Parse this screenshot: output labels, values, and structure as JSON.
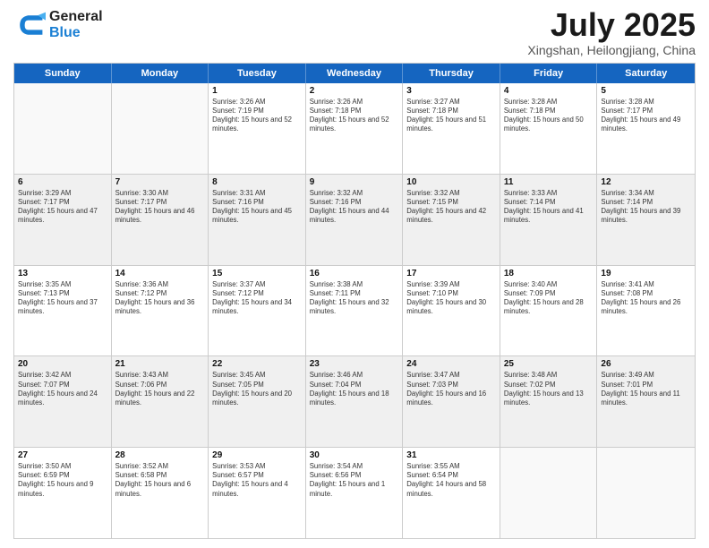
{
  "header": {
    "logo_general": "General",
    "logo_blue": "Blue",
    "month": "July 2025",
    "location": "Xingshan, Heilongjiang, China"
  },
  "weekdays": [
    "Sunday",
    "Monday",
    "Tuesday",
    "Wednesday",
    "Thursday",
    "Friday",
    "Saturday"
  ],
  "rows": [
    [
      {
        "day": "",
        "info": ""
      },
      {
        "day": "",
        "info": ""
      },
      {
        "day": "1",
        "info": "Sunrise: 3:26 AM\nSunset: 7:19 PM\nDaylight: 15 hours and 52 minutes."
      },
      {
        "day": "2",
        "info": "Sunrise: 3:26 AM\nSunset: 7:18 PM\nDaylight: 15 hours and 52 minutes."
      },
      {
        "day": "3",
        "info": "Sunrise: 3:27 AM\nSunset: 7:18 PM\nDaylight: 15 hours and 51 minutes."
      },
      {
        "day": "4",
        "info": "Sunrise: 3:28 AM\nSunset: 7:18 PM\nDaylight: 15 hours and 50 minutes."
      },
      {
        "day": "5",
        "info": "Sunrise: 3:28 AM\nSunset: 7:17 PM\nDaylight: 15 hours and 49 minutes."
      }
    ],
    [
      {
        "day": "6",
        "info": "Sunrise: 3:29 AM\nSunset: 7:17 PM\nDaylight: 15 hours and 47 minutes."
      },
      {
        "day": "7",
        "info": "Sunrise: 3:30 AM\nSunset: 7:17 PM\nDaylight: 15 hours and 46 minutes."
      },
      {
        "day": "8",
        "info": "Sunrise: 3:31 AM\nSunset: 7:16 PM\nDaylight: 15 hours and 45 minutes."
      },
      {
        "day": "9",
        "info": "Sunrise: 3:32 AM\nSunset: 7:16 PM\nDaylight: 15 hours and 44 minutes."
      },
      {
        "day": "10",
        "info": "Sunrise: 3:32 AM\nSunset: 7:15 PM\nDaylight: 15 hours and 42 minutes."
      },
      {
        "day": "11",
        "info": "Sunrise: 3:33 AM\nSunset: 7:14 PM\nDaylight: 15 hours and 41 minutes."
      },
      {
        "day": "12",
        "info": "Sunrise: 3:34 AM\nSunset: 7:14 PM\nDaylight: 15 hours and 39 minutes."
      }
    ],
    [
      {
        "day": "13",
        "info": "Sunrise: 3:35 AM\nSunset: 7:13 PM\nDaylight: 15 hours and 37 minutes."
      },
      {
        "day": "14",
        "info": "Sunrise: 3:36 AM\nSunset: 7:12 PM\nDaylight: 15 hours and 36 minutes."
      },
      {
        "day": "15",
        "info": "Sunrise: 3:37 AM\nSunset: 7:12 PM\nDaylight: 15 hours and 34 minutes."
      },
      {
        "day": "16",
        "info": "Sunrise: 3:38 AM\nSunset: 7:11 PM\nDaylight: 15 hours and 32 minutes."
      },
      {
        "day": "17",
        "info": "Sunrise: 3:39 AM\nSunset: 7:10 PM\nDaylight: 15 hours and 30 minutes."
      },
      {
        "day": "18",
        "info": "Sunrise: 3:40 AM\nSunset: 7:09 PM\nDaylight: 15 hours and 28 minutes."
      },
      {
        "day": "19",
        "info": "Sunrise: 3:41 AM\nSunset: 7:08 PM\nDaylight: 15 hours and 26 minutes."
      }
    ],
    [
      {
        "day": "20",
        "info": "Sunrise: 3:42 AM\nSunset: 7:07 PM\nDaylight: 15 hours and 24 minutes."
      },
      {
        "day": "21",
        "info": "Sunrise: 3:43 AM\nSunset: 7:06 PM\nDaylight: 15 hours and 22 minutes."
      },
      {
        "day": "22",
        "info": "Sunrise: 3:45 AM\nSunset: 7:05 PM\nDaylight: 15 hours and 20 minutes."
      },
      {
        "day": "23",
        "info": "Sunrise: 3:46 AM\nSunset: 7:04 PM\nDaylight: 15 hours and 18 minutes."
      },
      {
        "day": "24",
        "info": "Sunrise: 3:47 AM\nSunset: 7:03 PM\nDaylight: 15 hours and 16 minutes."
      },
      {
        "day": "25",
        "info": "Sunrise: 3:48 AM\nSunset: 7:02 PM\nDaylight: 15 hours and 13 minutes."
      },
      {
        "day": "26",
        "info": "Sunrise: 3:49 AM\nSunset: 7:01 PM\nDaylight: 15 hours and 11 minutes."
      }
    ],
    [
      {
        "day": "27",
        "info": "Sunrise: 3:50 AM\nSunset: 6:59 PM\nDaylight: 15 hours and 9 minutes."
      },
      {
        "day": "28",
        "info": "Sunrise: 3:52 AM\nSunset: 6:58 PM\nDaylight: 15 hours and 6 minutes."
      },
      {
        "day": "29",
        "info": "Sunrise: 3:53 AM\nSunset: 6:57 PM\nDaylight: 15 hours and 4 minutes."
      },
      {
        "day": "30",
        "info": "Sunrise: 3:54 AM\nSunset: 6:56 PM\nDaylight: 15 hours and 1 minute."
      },
      {
        "day": "31",
        "info": "Sunrise: 3:55 AM\nSunset: 6:54 PM\nDaylight: 14 hours and 58 minutes."
      },
      {
        "day": "",
        "info": ""
      },
      {
        "day": "",
        "info": ""
      }
    ]
  ]
}
